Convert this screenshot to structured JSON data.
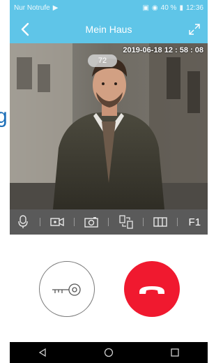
{
  "status_bar": {
    "carrier": "Nur Notrufe",
    "battery": "40 %",
    "time": "12:36"
  },
  "header": {
    "title": "Mein Haus"
  },
  "video": {
    "timestamp": "2019-06-18  12 : 58 : 08",
    "counter": "72"
  },
  "toolbar": {
    "f1_label": "F1",
    "icons": [
      "microphone-icon",
      "video-record-icon",
      "camera-icon",
      "switch-camera-icon",
      "door-icon"
    ]
  },
  "colors": {
    "header_bg": "#5fc5e8",
    "toolbar_bg": "#5a5a5a",
    "hangup_red": "#f0192f",
    "nav_bg": "#000000"
  }
}
